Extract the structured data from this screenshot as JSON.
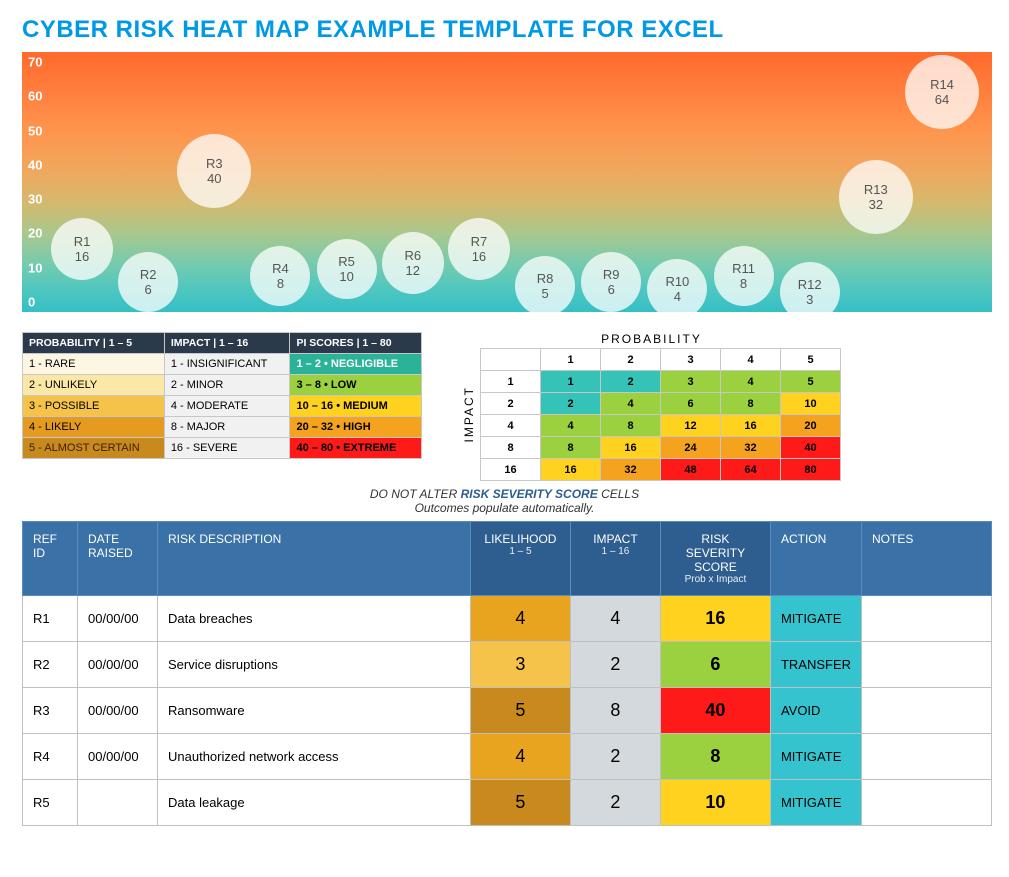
{
  "title": "CYBER RISK HEAT MAP EXAMPLE TEMPLATE FOR EXCEL",
  "chart_data": {
    "type": "scatter",
    "title": "",
    "xlabel": "",
    "ylabel": "",
    "ylim": [
      0,
      70
    ],
    "y_ticks": [
      0,
      10,
      20,
      30,
      40,
      50,
      60,
      70
    ],
    "series": [
      {
        "name": "R1",
        "x": 1,
        "y": 16,
        "label": "R1",
        "value": 16
      },
      {
        "name": "R2",
        "x": 2,
        "y": 6,
        "label": "R2",
        "value": 6
      },
      {
        "name": "R3",
        "x": 3,
        "y": 40,
        "label": "R3",
        "value": 40
      },
      {
        "name": "R4",
        "x": 4,
        "y": 8,
        "label": "R4",
        "value": 8
      },
      {
        "name": "R5",
        "x": 5,
        "y": 10,
        "label": "R5",
        "value": 10
      },
      {
        "name": "R6",
        "x": 6,
        "y": 12,
        "label": "R6",
        "value": 12
      },
      {
        "name": "R7",
        "x": 7,
        "y": 16,
        "label": "R7",
        "value": 16
      },
      {
        "name": "R8",
        "x": 8,
        "y": 5,
        "label": "R8",
        "value": 5
      },
      {
        "name": "R9",
        "x": 9,
        "y": 6,
        "label": "R9",
        "value": 6
      },
      {
        "name": "R10",
        "x": 10,
        "y": 4,
        "label": "R10",
        "value": 4
      },
      {
        "name": "R11",
        "x": 11,
        "y": 8,
        "label": "R11",
        "value": 8
      },
      {
        "name": "R12",
        "x": 12,
        "y": 3,
        "label": "R12",
        "value": 3
      },
      {
        "name": "R13",
        "x": 13,
        "y": 32,
        "label": "R13",
        "value": 32
      },
      {
        "name": "R14",
        "x": 14,
        "y": 64,
        "label": "R14",
        "value": 64
      }
    ]
  },
  "legend": {
    "headers": {
      "prob": "PROBABILITY | 1 – 5",
      "impact": "IMPACT | 1 – 16",
      "pi": "PI SCORES | 1 – 80"
    },
    "rows": [
      {
        "prob": "1 - RARE",
        "impact": "1 - INSIGNIFICANT",
        "pi": "1 – 2 • NEGLIGIBLE"
      },
      {
        "prob": "2 - UNLIKELY",
        "impact": "2 - MINOR",
        "pi": "3 – 8 • LOW"
      },
      {
        "prob": "3 - POSSIBLE",
        "impact": "4 - MODERATE",
        "pi": "10 – 16 • MEDIUM"
      },
      {
        "prob": "4 - LIKELY",
        "impact": "8 - MAJOR",
        "pi": "20 – 32 • HIGH"
      },
      {
        "prob": "5 - ALMOST CERTAIN",
        "impact": "16 - SEVERE",
        "pi": "40 – 80 • EXTREME"
      }
    ]
  },
  "matrix": {
    "xlabel": "PROBABILITY",
    "ylabel": "IMPACT",
    "col_headers": [
      "1",
      "2",
      "3",
      "4",
      "5"
    ],
    "row_headers": [
      "1",
      "2",
      "4",
      "8",
      "16"
    ],
    "cells": [
      [
        "1",
        "2",
        "3",
        "4",
        "5"
      ],
      [
        "2",
        "4",
        "6",
        "8",
        "10"
      ],
      [
        "4",
        "8",
        "12",
        "16",
        "20"
      ],
      [
        "8",
        "16",
        "24",
        "32",
        "40"
      ],
      [
        "16",
        "32",
        "48",
        "64",
        "80"
      ]
    ]
  },
  "note": {
    "prefix": "DO NOT ALTER ",
    "strong": "RISK SEVERITY SCORE",
    "suffix": " CELLS",
    "line2": "Outcomes populate automatically."
  },
  "risk_table": {
    "headers": {
      "ref": "REF ID",
      "date": "DATE RAISED",
      "desc": "RISK DESCRIPTION",
      "likelihood": "LIKELIHOOD",
      "likelihood_sub": "1 – 5",
      "impact": "IMPACT",
      "impact_sub": "1 – 16",
      "score": "RISK SEVERITY SCORE",
      "score_sub": "Prob  x  Impact",
      "action": "ACTION",
      "notes": "NOTES"
    },
    "rows": [
      {
        "ref": "R1",
        "date": "00/00/00",
        "desc": "Data breaches",
        "likelihood": "4",
        "impact": "4",
        "score": "16",
        "action": "MITIGATE",
        "notes": ""
      },
      {
        "ref": "R2",
        "date": "00/00/00",
        "desc": "Service disruptions",
        "likelihood": "3",
        "impact": "2",
        "score": "6",
        "action": "TRANSFER",
        "notes": ""
      },
      {
        "ref": "R3",
        "date": "00/00/00",
        "desc": "Ransomware",
        "likelihood": "5",
        "impact": "8",
        "score": "40",
        "action": "AVOID",
        "notes": ""
      },
      {
        "ref": "R4",
        "date": "00/00/00",
        "desc": "Unauthorized network access",
        "likelihood": "4",
        "impact": "2",
        "score": "8",
        "action": "MITIGATE",
        "notes": ""
      },
      {
        "ref": "R5",
        "date": "",
        "desc": "Data leakage",
        "likelihood": "5",
        "impact": "2",
        "score": "10",
        "action": "MITIGATE",
        "notes": ""
      }
    ]
  }
}
